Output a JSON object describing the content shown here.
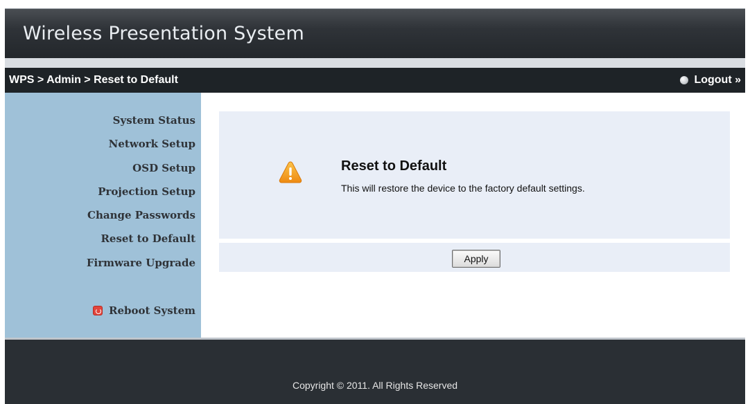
{
  "header": {
    "title": "Wireless Presentation System"
  },
  "breadcrumb": {
    "text": "WPS > Admin > Reset to Default",
    "logout_label": "Logout »"
  },
  "sidebar": {
    "items": [
      {
        "label": "System Status"
      },
      {
        "label": "Network Setup"
      },
      {
        "label": "OSD Setup"
      },
      {
        "label": "Projection Setup"
      },
      {
        "label": "Change Passwords"
      },
      {
        "label": "Reset to Default"
      },
      {
        "label": "Firmware Upgrade"
      }
    ],
    "reboot_label": "Reboot System"
  },
  "main": {
    "heading": "Reset to Default",
    "description": "This will restore the device to the factory default settings.",
    "apply_label": "Apply"
  },
  "footer": {
    "copyright": "Copyright © 2011. All Rights Reserved"
  },
  "colors": {
    "sidebar_bg": "#9fc1d8",
    "breadcrumb_bg": "#1e2327",
    "panel_bg": "#e9eef7",
    "warning_icon": "#f29a1f"
  },
  "icons": {
    "warning": "warning-icon",
    "logout": "logout-icon",
    "reboot": "power-icon"
  }
}
